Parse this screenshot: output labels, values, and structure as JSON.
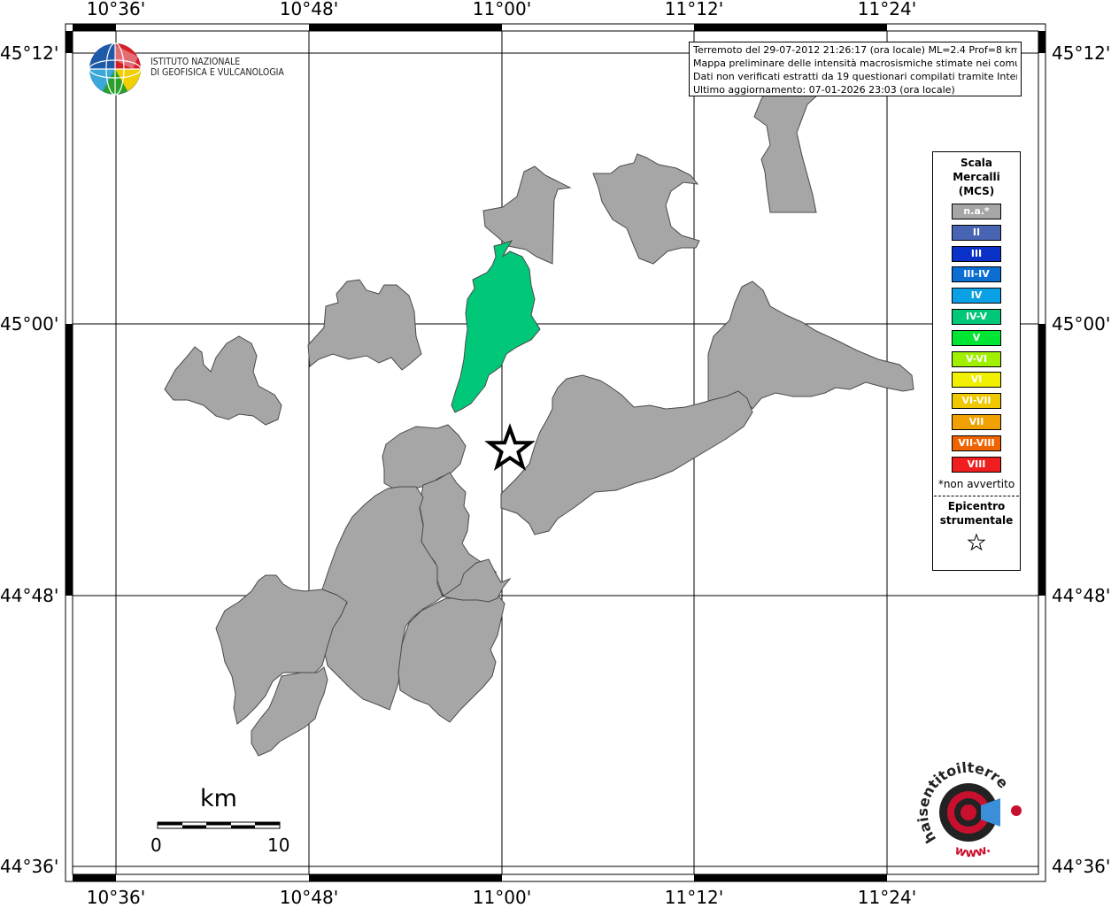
{
  "map": {
    "lon_ticks": [
      "10°36'",
      "10°48'",
      "11°00'",
      "11°12'",
      "11°24'"
    ],
    "lat_ticks": [
      "45°12'",
      "45°00'",
      "44°48'",
      "44°36'"
    ],
    "epicenter": {
      "shown": true,
      "symbol": "star"
    },
    "colors": {
      "na": "#a6a6a6",
      "iv_v": "#00c878",
      "border": "#4a4a4a"
    }
  },
  "header": {
    "org_name_line1": "ISTITUTO NAZIONALE",
    "org_name_line2": "DI GEOFISICA E VULCANOLOGIA"
  },
  "info": {
    "line1": "Terremoto del 29-07-2012 21:26:17 (ora locale) ML=2.4 Prof=8 km",
    "line2": "Mappa preliminare delle intensità macrosismiche stimate nei comuni",
    "line3": "Dati non verificati estratti da 19 questionari compilati tramite Internet.",
    "line4": "Ultimo aggiornamento: 07-01-2026 23:03 (ora locale)"
  },
  "legend": {
    "title_line1": "Scala",
    "title_line2": "Mercalli",
    "title_line3": "(MCS)",
    "items": [
      {
        "label": "n.a.*",
        "color": "#a6a6a6"
      },
      {
        "label": "II",
        "color": "#4a64b4"
      },
      {
        "label": "III",
        "color": "#0a32c8"
      },
      {
        "label": "III-IV",
        "color": "#0a6ed2"
      },
      {
        "label": "IV",
        "color": "#0aa0e6"
      },
      {
        "label": "IV-V",
        "color": "#00c878"
      },
      {
        "label": "V",
        "color": "#00e632"
      },
      {
        "label": "V-VI",
        "color": "#a0f000"
      },
      {
        "label": "VI",
        "color": "#f0f000"
      },
      {
        "label": "VI-VII",
        "color": "#f0c800"
      },
      {
        "label": "VII",
        "color": "#f0a000"
      },
      {
        "label": "VII-VIII",
        "color": "#f06400"
      },
      {
        "label": "VIII",
        "color": "#f01e1e"
      }
    ],
    "note": "*non avvertito",
    "epicenter_line1": "Epicentro",
    "epicenter_line2": "strumentale"
  },
  "scale": {
    "unit": "km",
    "start": "0",
    "end": "10"
  },
  "logos": {
    "hsit_text": "haisentitoilterremoto.it",
    "hsit_www": "www."
  }
}
